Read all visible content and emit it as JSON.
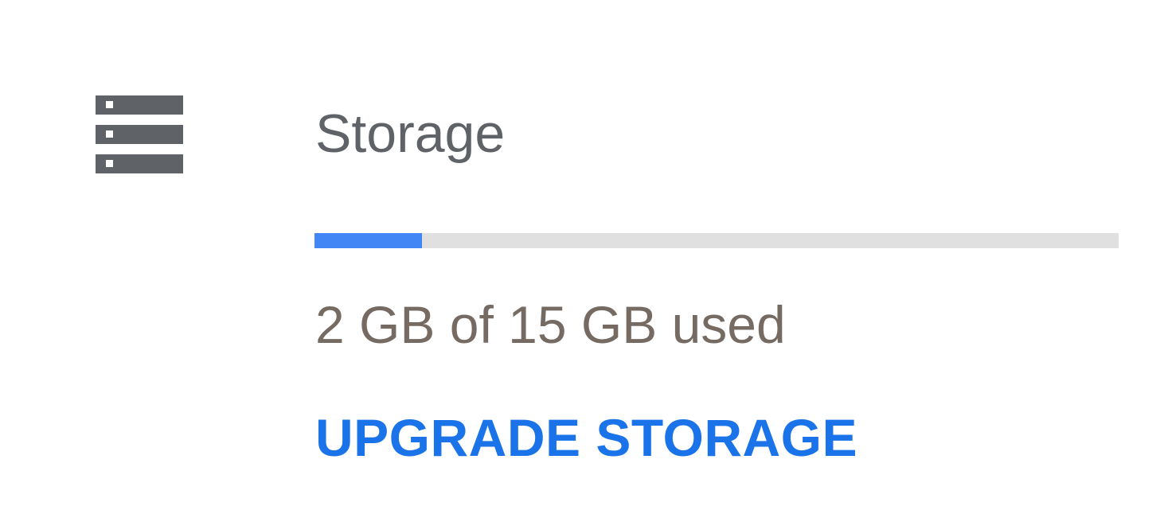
{
  "storage": {
    "icon": "storage-icon",
    "title": "Storage",
    "used_fraction": 0.1333,
    "usage_text": "2 GB of 15 GB used",
    "upgrade_label": "UPGRADE STORAGE"
  },
  "colors": {
    "accent": "#4285f4",
    "track": "#e0e0e0",
    "link": "#1a73e8",
    "title_text": "#5f6368",
    "usage_text": "#756b63",
    "icon": "#5f6368"
  }
}
